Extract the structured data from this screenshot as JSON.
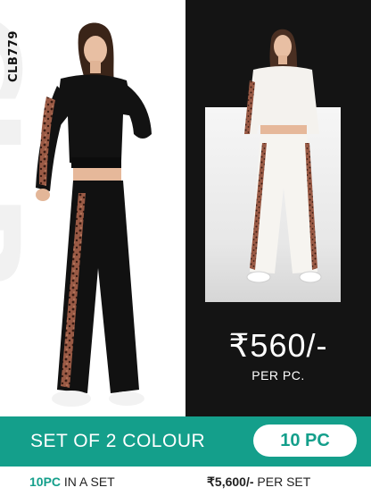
{
  "product": {
    "code": "CLB779",
    "watermark": "CLB"
  },
  "price": {
    "amount": "₹560/-",
    "unit": "PER PC."
  },
  "banner": {
    "text": "SET OF 2 COLOUR",
    "pill_label": "10 PC"
  },
  "footer": {
    "pieces_highlight": "10PC",
    "pieces_rest": " IN A SET",
    "set_price": "₹5,600/-",
    "set_price_suffix": " PER SET"
  },
  "colors": {
    "accent": "#149f8b",
    "dark_panel": "#141414",
    "white": "#ffffff",
    "outfit_black": "#111111",
    "outfit_white": "#f4f2ee",
    "leopard": "#8a4b3a"
  }
}
